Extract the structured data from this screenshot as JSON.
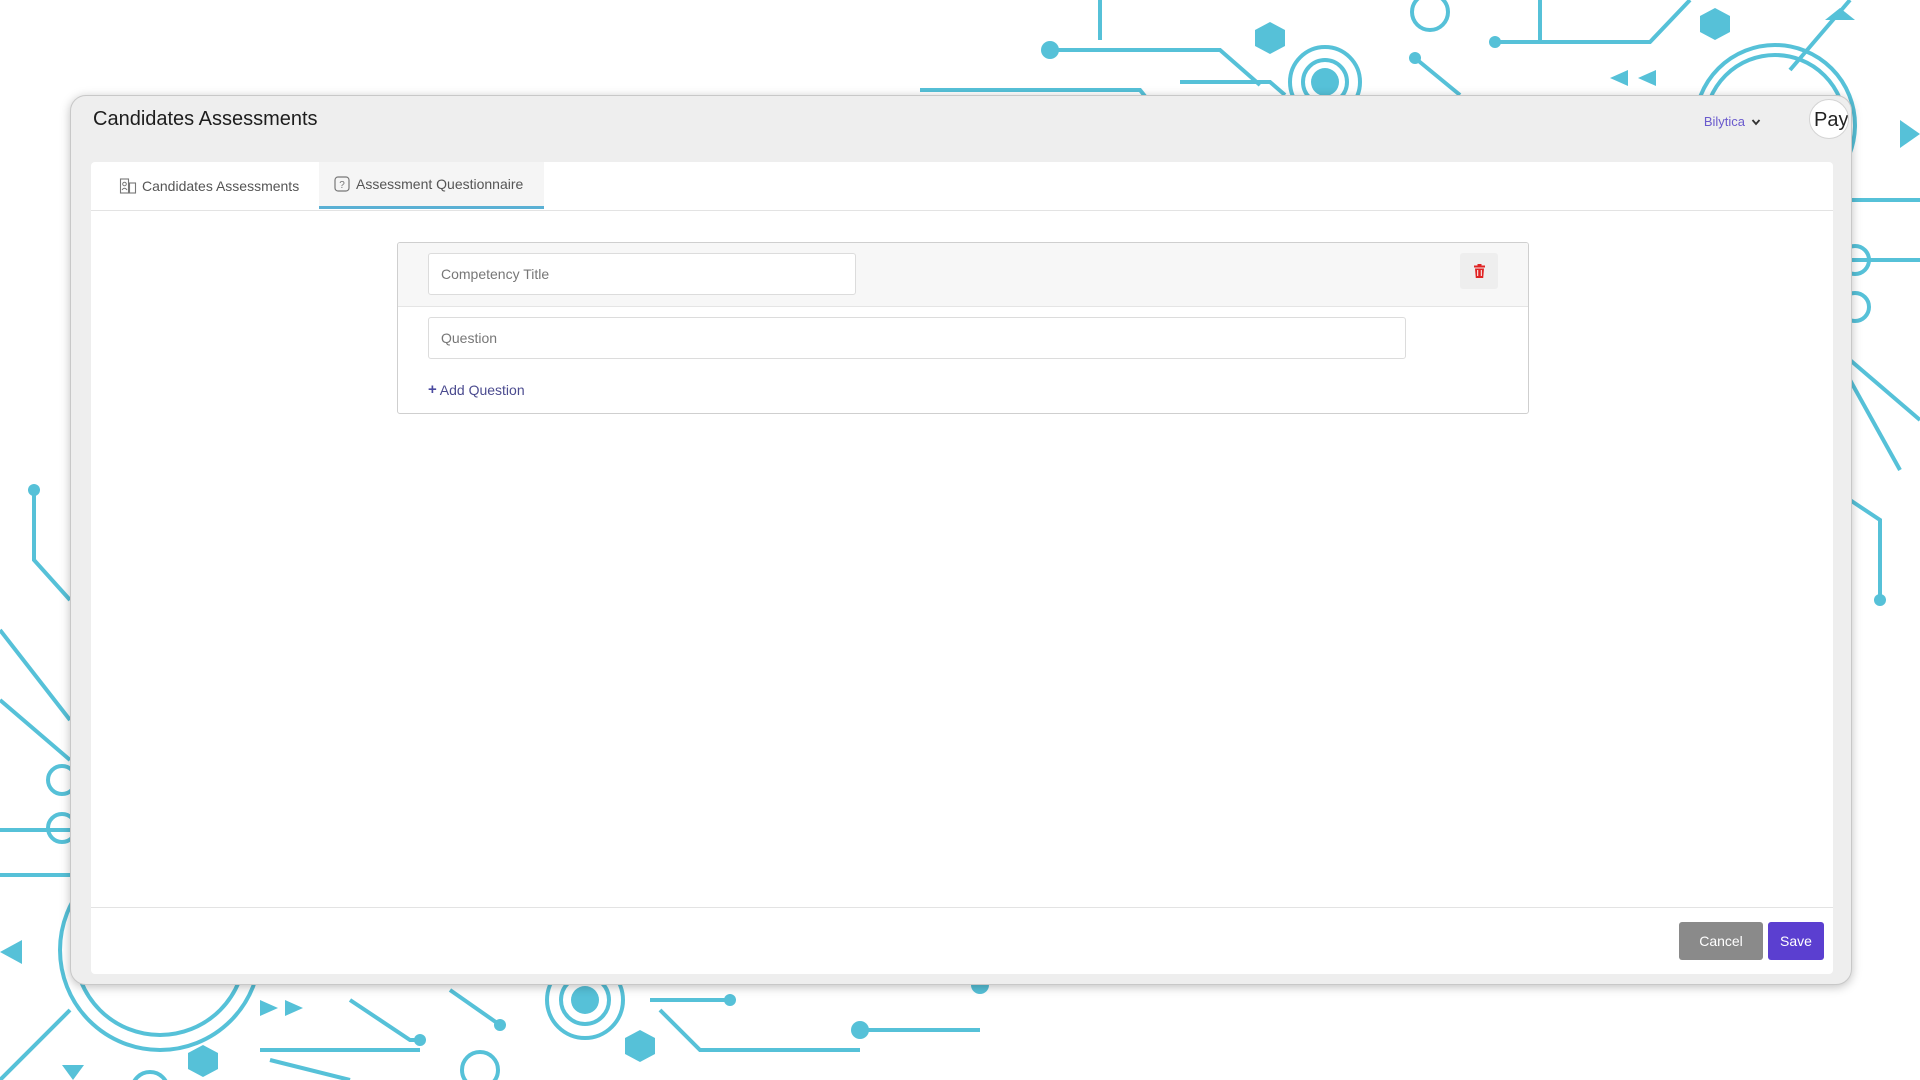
{
  "window": {
    "title": "Candidates Assessments"
  },
  "header": {
    "user_label": "Bilytica",
    "avatar_text": "Pay"
  },
  "tabs": [
    {
      "label": "Candidates Assessments",
      "icon": "clipboard-user-icon",
      "active": false
    },
    {
      "label": "Assessment Questionnaire",
      "icon": "question-box-icon",
      "active": true
    }
  ],
  "form": {
    "competency_title": {
      "placeholder": "Competency Title",
      "value": ""
    },
    "question": {
      "placeholder": "Question",
      "value": ""
    },
    "add_question_label": "Add Question",
    "delete_icon": "trash-icon"
  },
  "footer": {
    "cancel_label": "Cancel",
    "save_label": "Save"
  },
  "colors": {
    "accent": "#5b3fd0",
    "tab_underline": "#5ab0d4",
    "delete": "#e02424",
    "cancel": "#8a8a8a",
    "user_link": "#6a5acd",
    "background_art": "#4fc3d9"
  }
}
